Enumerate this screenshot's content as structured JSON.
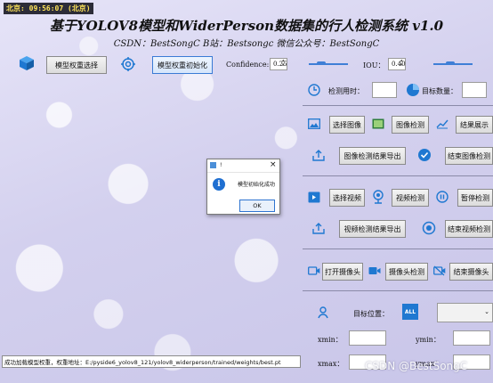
{
  "header": {
    "clock": "北京: 09:56:07 (北京)",
    "title": "基于YOLOV8模型和WiderPerson数据集的行人检测系统 v1.0",
    "subtitle": "CSDN：BestSongC   B站：Bestsongc   微信公众号：BestSongC"
  },
  "toolbar": {
    "weight_select": "模型权重选择",
    "weight_init": "模型权重初始化",
    "confidence_label": "Confidence:",
    "confidence_value": "0.25",
    "iou_label": "IOU：",
    "iou_value": "0.40",
    "confidence_fraction": 0.25,
    "iou_fraction": 0.4
  },
  "stats": {
    "time_label": "检测用时：",
    "time_value": "",
    "count_label": "目标数量：",
    "count_value": ""
  },
  "image_section": {
    "select": "选择图像",
    "detect": "图像检测",
    "show": "结果展示",
    "export": "图像检测结果导出",
    "end": "结束图像检测"
  },
  "video_section": {
    "select": "选择视频",
    "detect": "视频检测",
    "pause": "暂停检测",
    "export": "视频检测结果导出",
    "end": "结束视频检测"
  },
  "camera_section": {
    "open": "打开摄像头",
    "detect": "摄像头检测",
    "end": "结束摄像头"
  },
  "position": {
    "label": "目标位置：",
    "all_icon_text": "ALL",
    "xmin": "xmin：",
    "ymin": "ymin：",
    "xmax": "xmax：",
    "ymax": "ymax："
  },
  "status_bar": {
    "text": "成功加载模型权重，权重地址：E:/pyside6_yolov8_121/yolov8_widerperson/trained/weights/best.pt"
  },
  "dialog": {
    "title": "!",
    "message": "模型初始化成功",
    "ok": "OK"
  },
  "watermark": "CSDN @BestSongC",
  "colors": {
    "accent": "#2f74d0",
    "icon_blue": "#1f78d1",
    "background": "#d3d0ee"
  }
}
